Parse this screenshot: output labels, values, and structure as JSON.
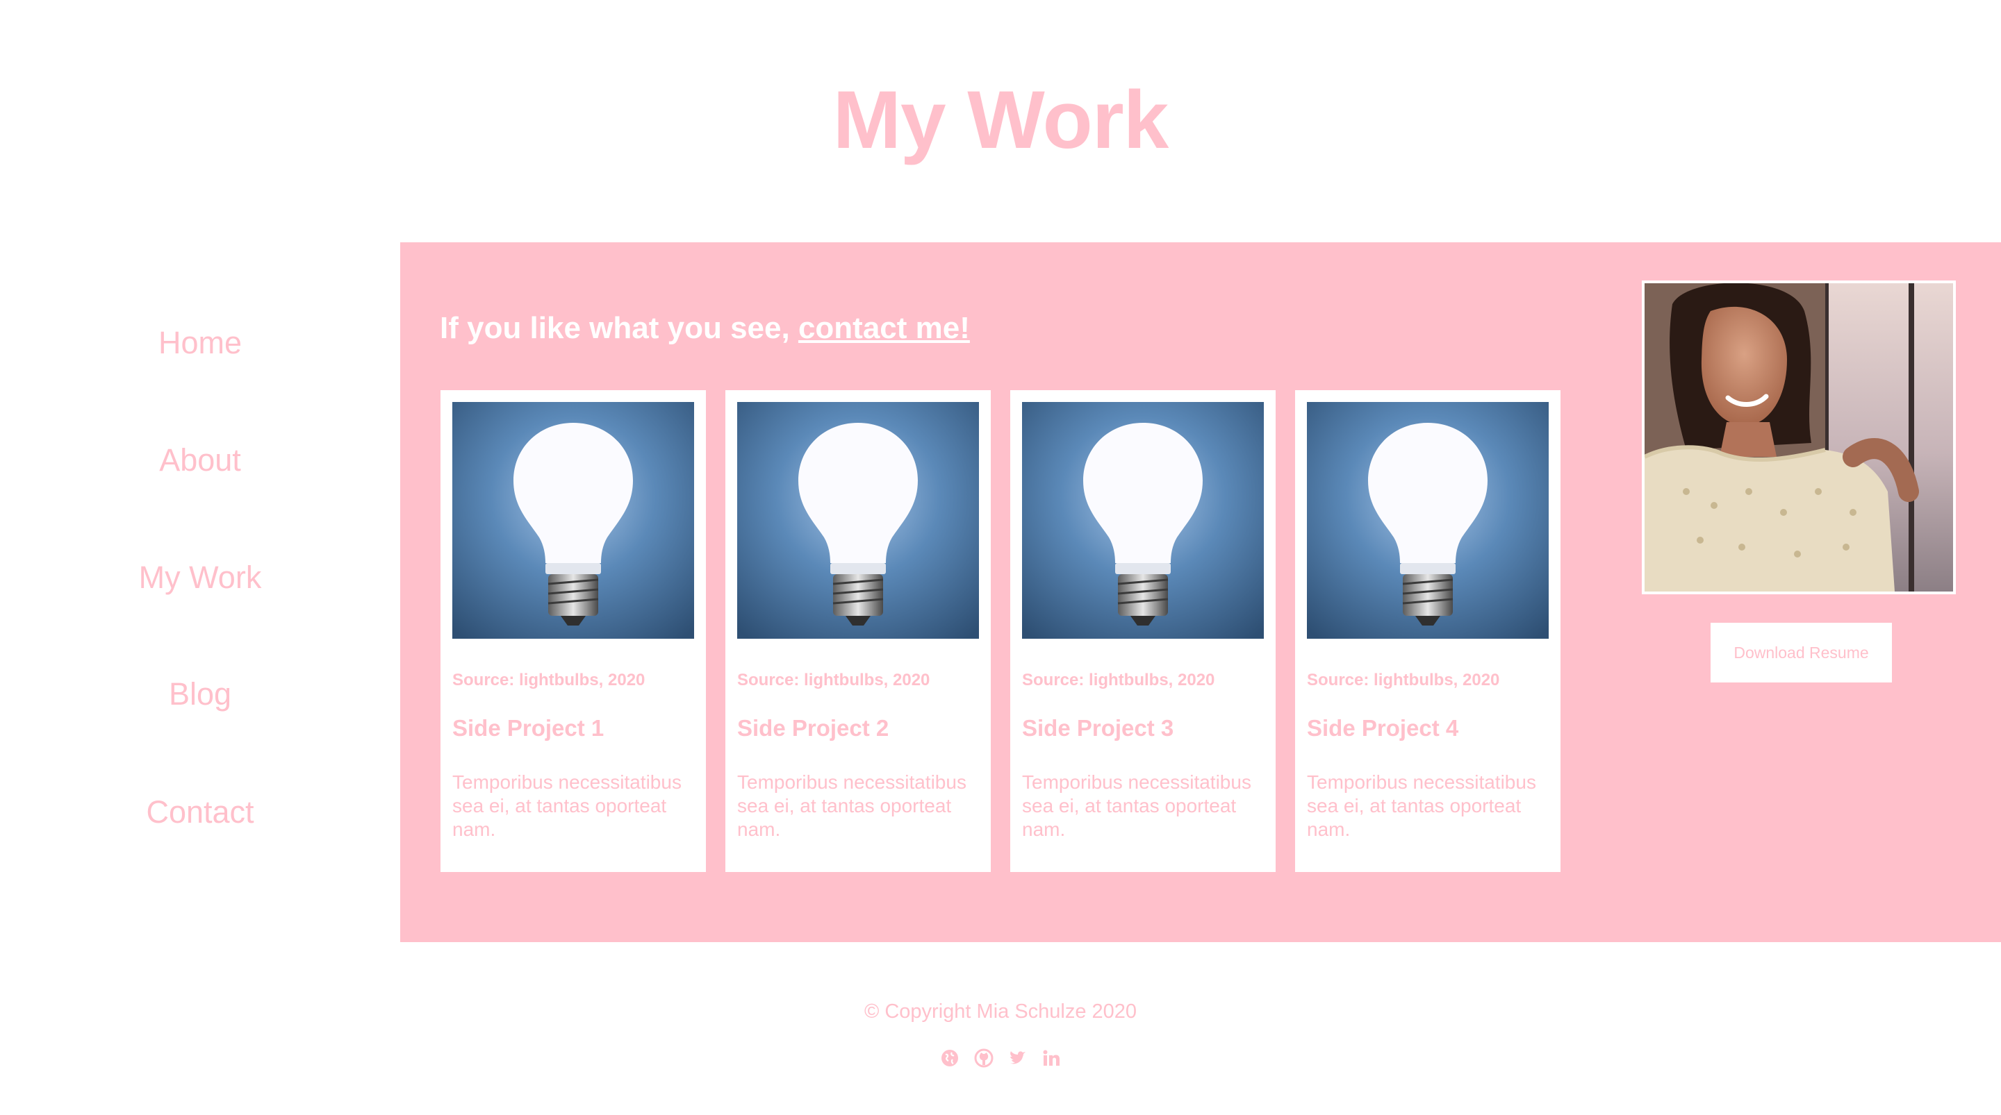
{
  "page": {
    "title": "My Work"
  },
  "nav": {
    "items": [
      {
        "label": "Home"
      },
      {
        "label": "About"
      },
      {
        "label": "My Work"
      },
      {
        "label": "Blog"
      },
      {
        "label": "Contact"
      }
    ]
  },
  "main": {
    "tagline_prefix": "If you like what you see, ",
    "tagline_link": "contact me!",
    "cards": [
      {
        "image": "lightbulb",
        "source": "Source: lightbulbs, 2020",
        "title": "Side Project 1",
        "description": "Temporibus necessitatibus sea ei, at tantas oporteat nam."
      },
      {
        "image": "lightbulb",
        "source": "Source: lightbulbs, 2020",
        "title": "Side Project 2",
        "description": "Temporibus necessitatibus sea ei, at tantas oporteat nam."
      },
      {
        "image": "lightbulb",
        "source": "Source: lightbulbs, 2020",
        "title": "Side Project 3",
        "description": "Temporibus necessitatibus sea ei, at tantas oporteat nam."
      },
      {
        "image": "lightbulb",
        "source": "Source: lightbulbs, 2020",
        "title": "Side Project 4",
        "description": "Temporibus necessitatibus sea ei, at tantas oporteat nam."
      }
    ],
    "profile_photo": "portrait",
    "resume_button": "Download Resume"
  },
  "footer": {
    "copyright": "© Copyright Mia Schulze 2020",
    "social_icons": [
      "globe-icon",
      "github-icon",
      "twitter-icon",
      "linkedin-icon"
    ]
  },
  "colors": {
    "accent": "#ffc0cb",
    "background": "#ffffff",
    "tagline": "#ffffff"
  }
}
